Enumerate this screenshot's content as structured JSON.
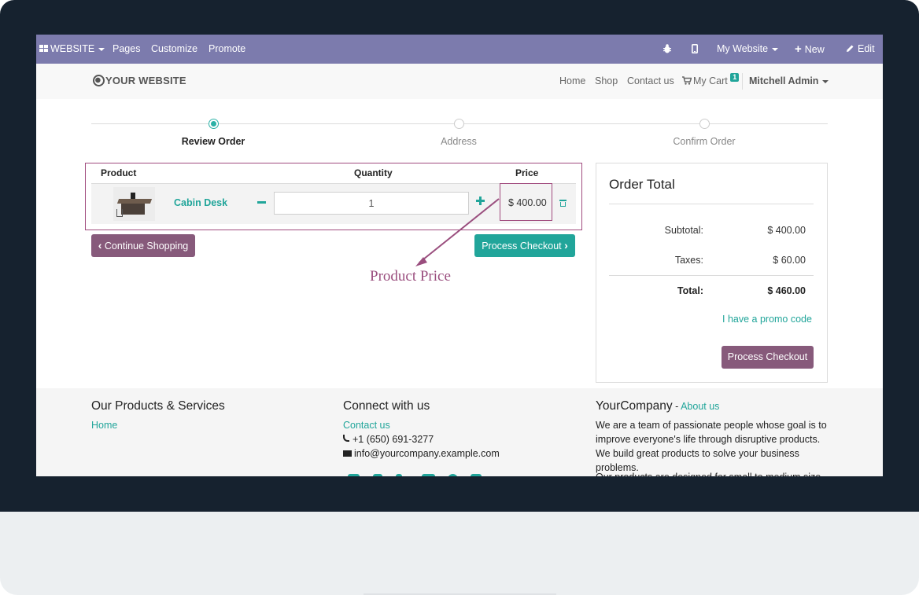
{
  "adminbar": {
    "website_menu": "WEBSITE",
    "pages": "Pages",
    "customize": "Customize",
    "promote": "Promote",
    "my_website": "My Website",
    "new": "New",
    "edit": "Edit",
    "color": "#7c7bad"
  },
  "header": {
    "logo_text": "YOUR WEBSITE",
    "nav": [
      "Home",
      "Shop",
      "Contact us"
    ],
    "cart_label": "My Cart",
    "cart_count": "1",
    "user": "Mitchell Admin"
  },
  "steps": [
    "Review Order",
    "Address",
    "Confirm Order"
  ],
  "cart": {
    "headers": {
      "product": "Product",
      "quantity": "Quantity",
      "price": "Price"
    },
    "items": [
      {
        "name": "Cabin Desk",
        "quantity": "1",
        "price": "$ 400.00"
      }
    ],
    "continue_label": "Continue Shopping",
    "process_label": "Process Checkout"
  },
  "annotation": "Product Price",
  "order_total": {
    "title": "Order Total",
    "subtotal_label": "Subtotal:",
    "subtotal": "$ 400.00",
    "taxes_label": "Taxes:",
    "taxes": "$ 60.00",
    "total_label": "Total:",
    "total": "$ 460.00",
    "promo": "I have a promo code",
    "process_label": "Process Checkout"
  },
  "footer": {
    "col1_title": "Our Products & Services",
    "col1_link": "Home",
    "col2_title": "Connect with us",
    "col2_link": "Contact us",
    "phone": "+1 (650) 691-3277",
    "email": "info@yourcompany.example.com",
    "col3_title": "YourCompany",
    "col3_sep": " - ",
    "col3_link": "About us",
    "col3_text": "We are a team of passionate people whose goal is to improve everyone's life through disruptive products. We build great products to solve your business problems.",
    "col3_text2": "Our products are designed for small to medium size"
  },
  "colors": {
    "accent": "#21a59a",
    "primary": "#875a7b",
    "annotation": "#a04b7e"
  }
}
